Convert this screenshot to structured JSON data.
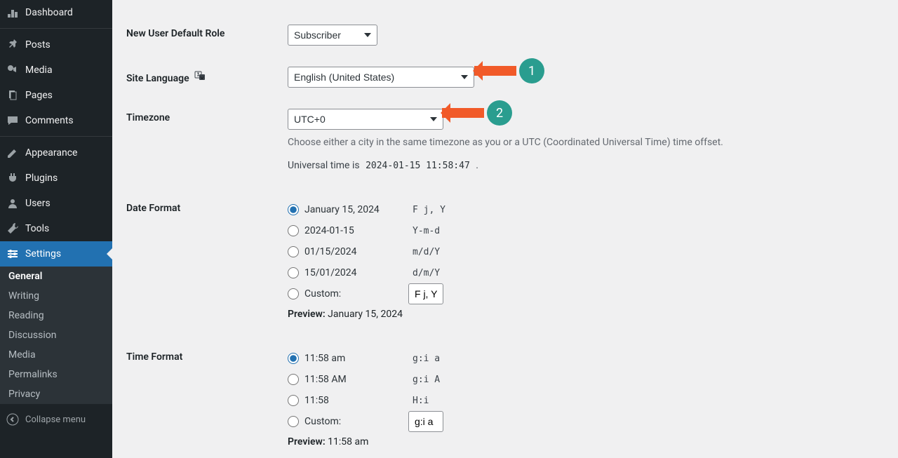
{
  "sidebar": {
    "items": [
      {
        "icon": "dashboard",
        "label": "Dashboard",
        "id": "dashboard"
      },
      {
        "icon": "pin",
        "label": "Posts",
        "id": "posts"
      },
      {
        "icon": "media",
        "label": "Media",
        "id": "media"
      },
      {
        "icon": "pages",
        "label": "Pages",
        "id": "pages"
      },
      {
        "icon": "comment",
        "label": "Comments",
        "id": "comments"
      },
      {
        "divider": true
      },
      {
        "icon": "appearance",
        "label": "Appearance",
        "id": "appearance"
      },
      {
        "icon": "plugin",
        "label": "Plugins",
        "id": "plugins"
      },
      {
        "icon": "users",
        "label": "Users",
        "id": "users"
      },
      {
        "icon": "tools",
        "label": "Tools",
        "id": "tools"
      },
      {
        "icon": "settings",
        "label": "Settings",
        "id": "settings",
        "current": true
      }
    ],
    "submenu": [
      {
        "label": "General",
        "active": true
      },
      {
        "label": "Writing"
      },
      {
        "label": "Reading"
      },
      {
        "label": "Discussion"
      },
      {
        "label": "Media"
      },
      {
        "label": "Permalinks"
      },
      {
        "label": "Privacy"
      }
    ],
    "collapse": "Collapse menu"
  },
  "form": {
    "new_user_role": {
      "label": "New User Default Role",
      "value": "Subscriber"
    },
    "site_language": {
      "label": "Site Language",
      "value": "English (United States)"
    },
    "timezone": {
      "label": "Timezone",
      "value": "UTC+0",
      "help": "Choose either a city in the same timezone as you or a UTC (Coordinated Universal Time) time offset.",
      "universal_prefix": "Universal time is ",
      "universal_time": "2024-01-15 11:58:47",
      "universal_suffix": "."
    },
    "date_format": {
      "label": "Date Format",
      "options": [
        {
          "text": "January 15, 2024",
          "code": "F j, Y",
          "checked": true
        },
        {
          "text": "2024-01-15",
          "code": "Y-m-d"
        },
        {
          "text": "01/15/2024",
          "code": "m/d/Y"
        },
        {
          "text": "15/01/2024",
          "code": "d/m/Y"
        }
      ],
      "custom_label": "Custom:",
      "custom_value": "F j, Y",
      "preview_label": "Preview:",
      "preview_value": "January 15, 2024"
    },
    "time_format": {
      "label": "Time Format",
      "options": [
        {
          "text": "11:58 am",
          "code": "g:i a",
          "checked": true
        },
        {
          "text": "11:58 AM",
          "code": "g:i A"
        },
        {
          "text": "11:58",
          "code": "H:i"
        }
      ],
      "custom_label": "Custom:",
      "custom_value": "g:i a",
      "preview_label": "Preview:",
      "preview_value": "11:58 am"
    }
  },
  "annotations": {
    "a1": "1",
    "a2": "2"
  }
}
